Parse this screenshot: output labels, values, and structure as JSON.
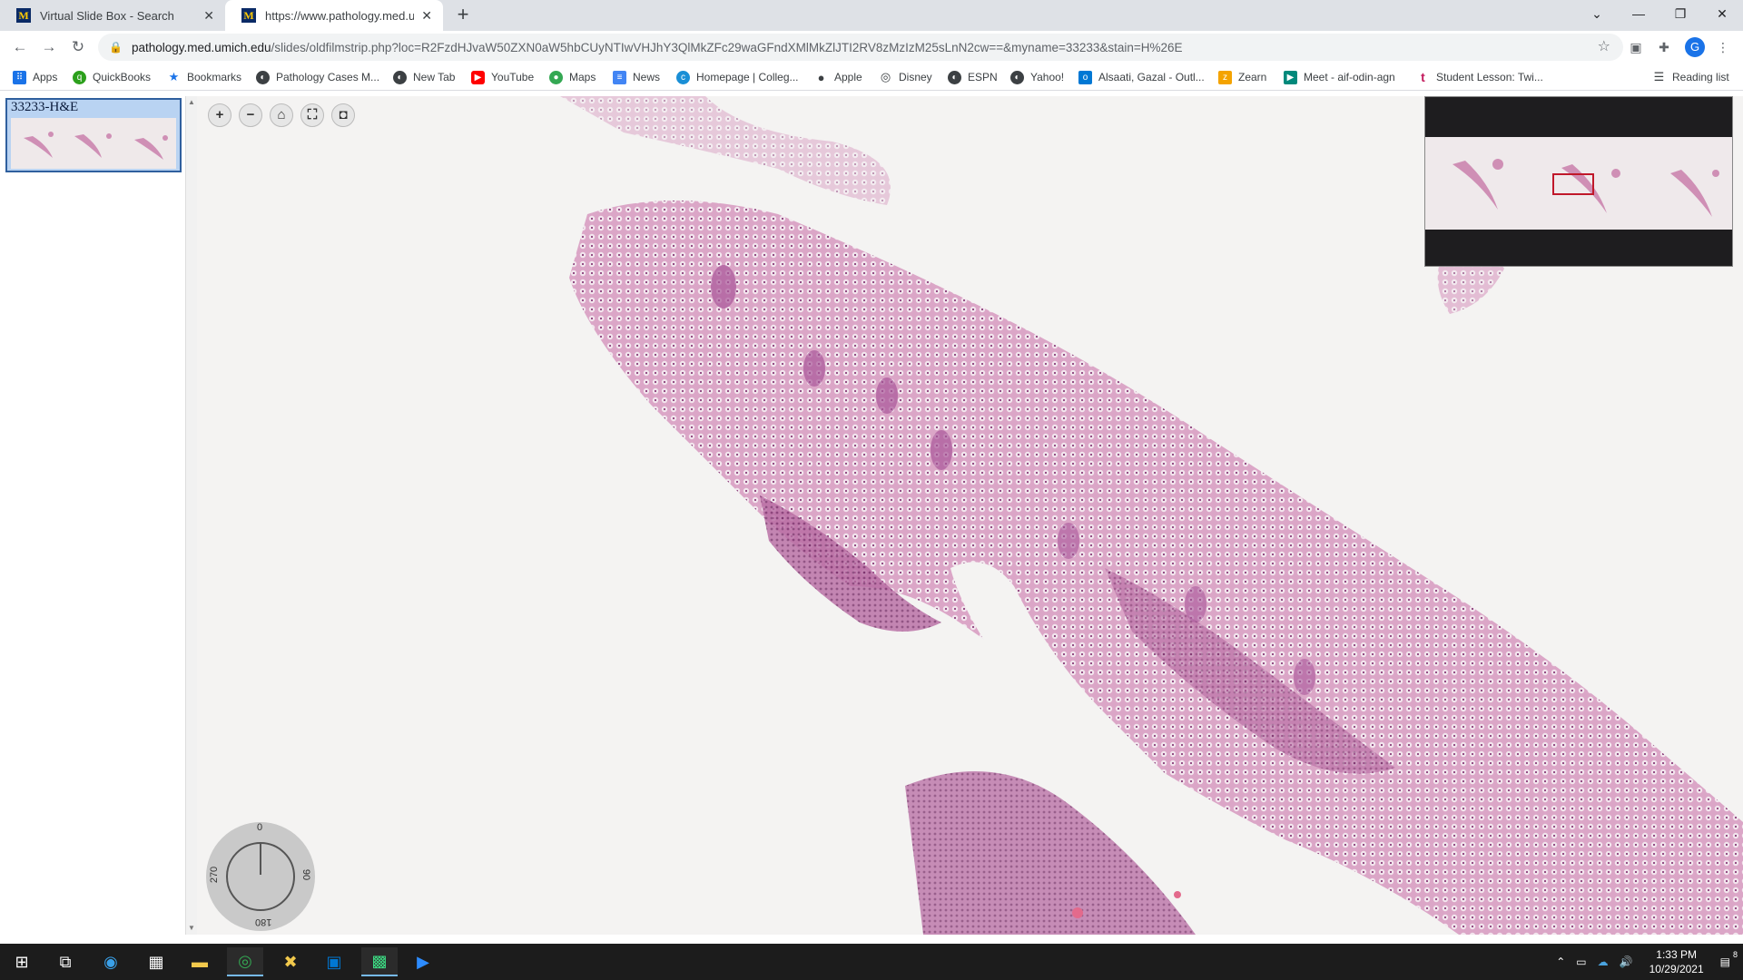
{
  "tabs": [
    {
      "title": "Virtual Slide Box - Search",
      "favicon": "M"
    },
    {
      "title": "https://www.pathology.med.umich.e",
      "favicon": "M"
    }
  ],
  "address": {
    "host": "pathology.med.umich.edu",
    "path": "/slides/oldfilmstrip.php?loc=R2FzdHJvaW50ZXN0aW5hbCUyNTIwVHJhY3QlMkZFc29waGFndXMlMkZlJTI2RV8zMzIzM25sLnN2cw==&myname=33233&stain=H%26E"
  },
  "profile_initial": "G",
  "bookmarks": [
    {
      "label": "Apps",
      "icon": "apps-grid-icon",
      "color": "#1a73e8"
    },
    {
      "label": "QuickBooks",
      "icon": "quickbooks-icon",
      "color": "#2ca01c"
    },
    {
      "label": "Bookmarks",
      "icon": "star-icon",
      "color": "#1a73e8"
    },
    {
      "label": "Pathology Cases M...",
      "icon": "globe-icon",
      "color": "#3c4043"
    },
    {
      "label": "New Tab",
      "icon": "globe-icon",
      "color": "#3c4043"
    },
    {
      "label": "YouTube",
      "icon": "youtube-icon",
      "color": "#ff0000"
    },
    {
      "label": "Maps",
      "icon": "maps-pin-icon",
      "color": "#34a853"
    },
    {
      "label": "News",
      "icon": "news-icon",
      "color": "#4285f4"
    },
    {
      "label": "Homepage | Colleg...",
      "icon": "college-icon",
      "color": "#1a8fd6"
    },
    {
      "label": "Apple",
      "icon": "apple-icon",
      "color": "#3c4043"
    },
    {
      "label": "Disney",
      "icon": "disney-icon",
      "color": "#3c4043"
    },
    {
      "label": "ESPN",
      "icon": "globe-icon",
      "color": "#3c4043"
    },
    {
      "label": "Yahoo!",
      "icon": "globe-icon",
      "color": "#3c4043"
    },
    {
      "label": "Alsaati, Gazal - Outl...",
      "icon": "outlook-icon",
      "color": "#0078d4"
    },
    {
      "label": "Zearn",
      "icon": "zearn-icon",
      "color": "#f4a300"
    },
    {
      "label": "Meet - aif-odin-agn",
      "icon": "meet-icon",
      "color": "#00897b"
    },
    {
      "label": "Student Lesson: Twi...",
      "icon": "t-icon",
      "color": "#c2185b"
    }
  ],
  "reading_list": "Reading list",
  "slide": {
    "thumbnail_label": "33233-H&E"
  },
  "dial": {
    "top": "0",
    "right": "90",
    "bottom": "180",
    "left": "270"
  },
  "clock": {
    "time": "1:33 PM",
    "date": "10/29/2021"
  },
  "notification_count": "8",
  "colors": {
    "tissue": "#d79bbf",
    "tissue_dark": "#a24f88",
    "overview_box": "#c0182a"
  }
}
